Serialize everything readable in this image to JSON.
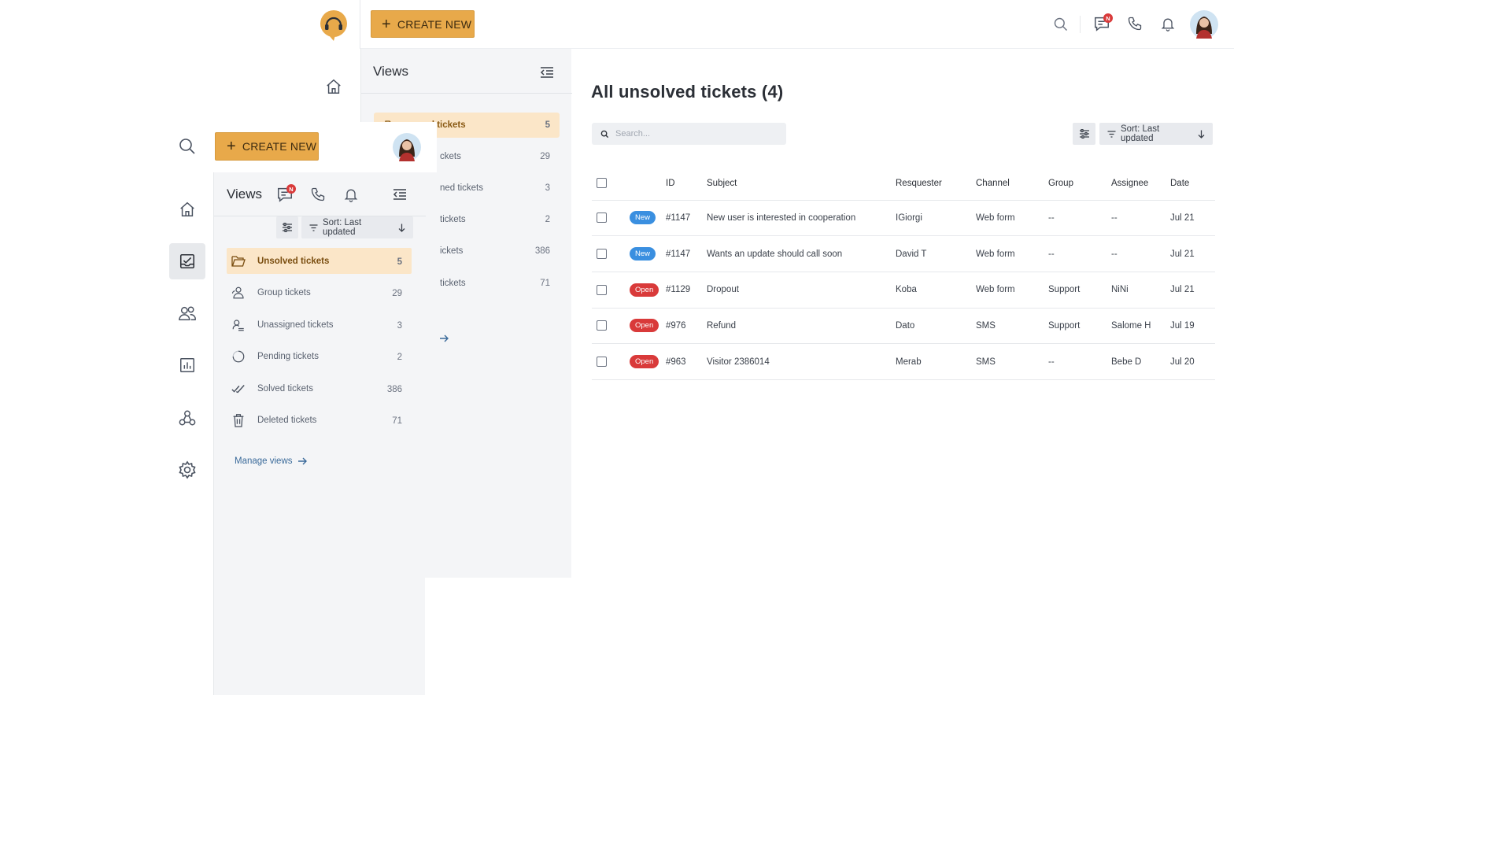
{
  "create_label": "CREATE NEW",
  "header": {
    "notif_badge": "N"
  },
  "views_back": {
    "title": "Views",
    "rows": [
      {
        "label": "d tickets",
        "count": "5"
      },
      {
        "label": "ckets",
        "count": "29"
      },
      {
        "label": "ned tickets",
        "count": "3"
      },
      {
        "label": "tickets",
        "count": "2"
      },
      {
        "label": "ickets",
        "count": "386"
      },
      {
        "label": "tickets",
        "count": "71"
      }
    ]
  },
  "front": {
    "views_title": "Views",
    "sort_label": "Sort: Last updated",
    "views": [
      {
        "label": "Unsolved tickets",
        "count": "5",
        "icon": "folder-icon"
      },
      {
        "label": "Group tickets",
        "count": "29",
        "icon": "group-icon"
      },
      {
        "label": "Unassigned tickets",
        "count": "3",
        "icon": "unassigned-icon"
      },
      {
        "label": "Pending tickets",
        "count": "2",
        "icon": "pending-icon"
      },
      {
        "label": "Solved tickets",
        "count": "386",
        "icon": "check-double-icon"
      },
      {
        "label": "Deleted tickets",
        "count": "71",
        "icon": "trash-icon"
      }
    ],
    "manage_views": "Manage views"
  },
  "main": {
    "title": "All unsolved tickets (4)",
    "search_placeholder": "Search...",
    "sort_label": "Sort: Last updated",
    "columns": [
      "ID",
      "Subject",
      "Resquester",
      "Channel",
      "Group",
      "Assignee",
      "Date"
    ],
    "rows": [
      {
        "status": "New",
        "id": "#1147",
        "subject": "New user is interested in cooperation",
        "requester": "IGiorgi",
        "channel": "Web form",
        "group": "--",
        "assignee": "--",
        "date": "Jul 21"
      },
      {
        "status": "New",
        "id": "#1147",
        "subject": "Wants an update should call soon",
        "requester": "David T",
        "channel": "Web form",
        "group": "--",
        "assignee": "--",
        "date": "Jul 21"
      },
      {
        "status": "Open",
        "id": "#1129",
        "subject": "Dropout",
        "requester": "Koba",
        "channel": "Web form",
        "group": "Support",
        "assignee": "NiNi",
        "date": "Jul 21"
      },
      {
        "status": "Open",
        "id": "#976",
        "subject": "Refund",
        "requester": "Dato",
        "channel": "SMS",
        "group": "Support",
        "assignee": "Salome H",
        "date": "Jul 19"
      },
      {
        "status": "Open",
        "id": "#963",
        "subject": "Visitor 2386014",
        "requester": "Merab",
        "channel": "SMS",
        "group": "--",
        "assignee": "Bebe D",
        "date": "Jul 20"
      }
    ]
  },
  "colors": {
    "accent": "#e8a94a",
    "new_badge": "#3a8fe0",
    "open_badge": "#d93a3a",
    "active_row": "#fbe6c8"
  }
}
